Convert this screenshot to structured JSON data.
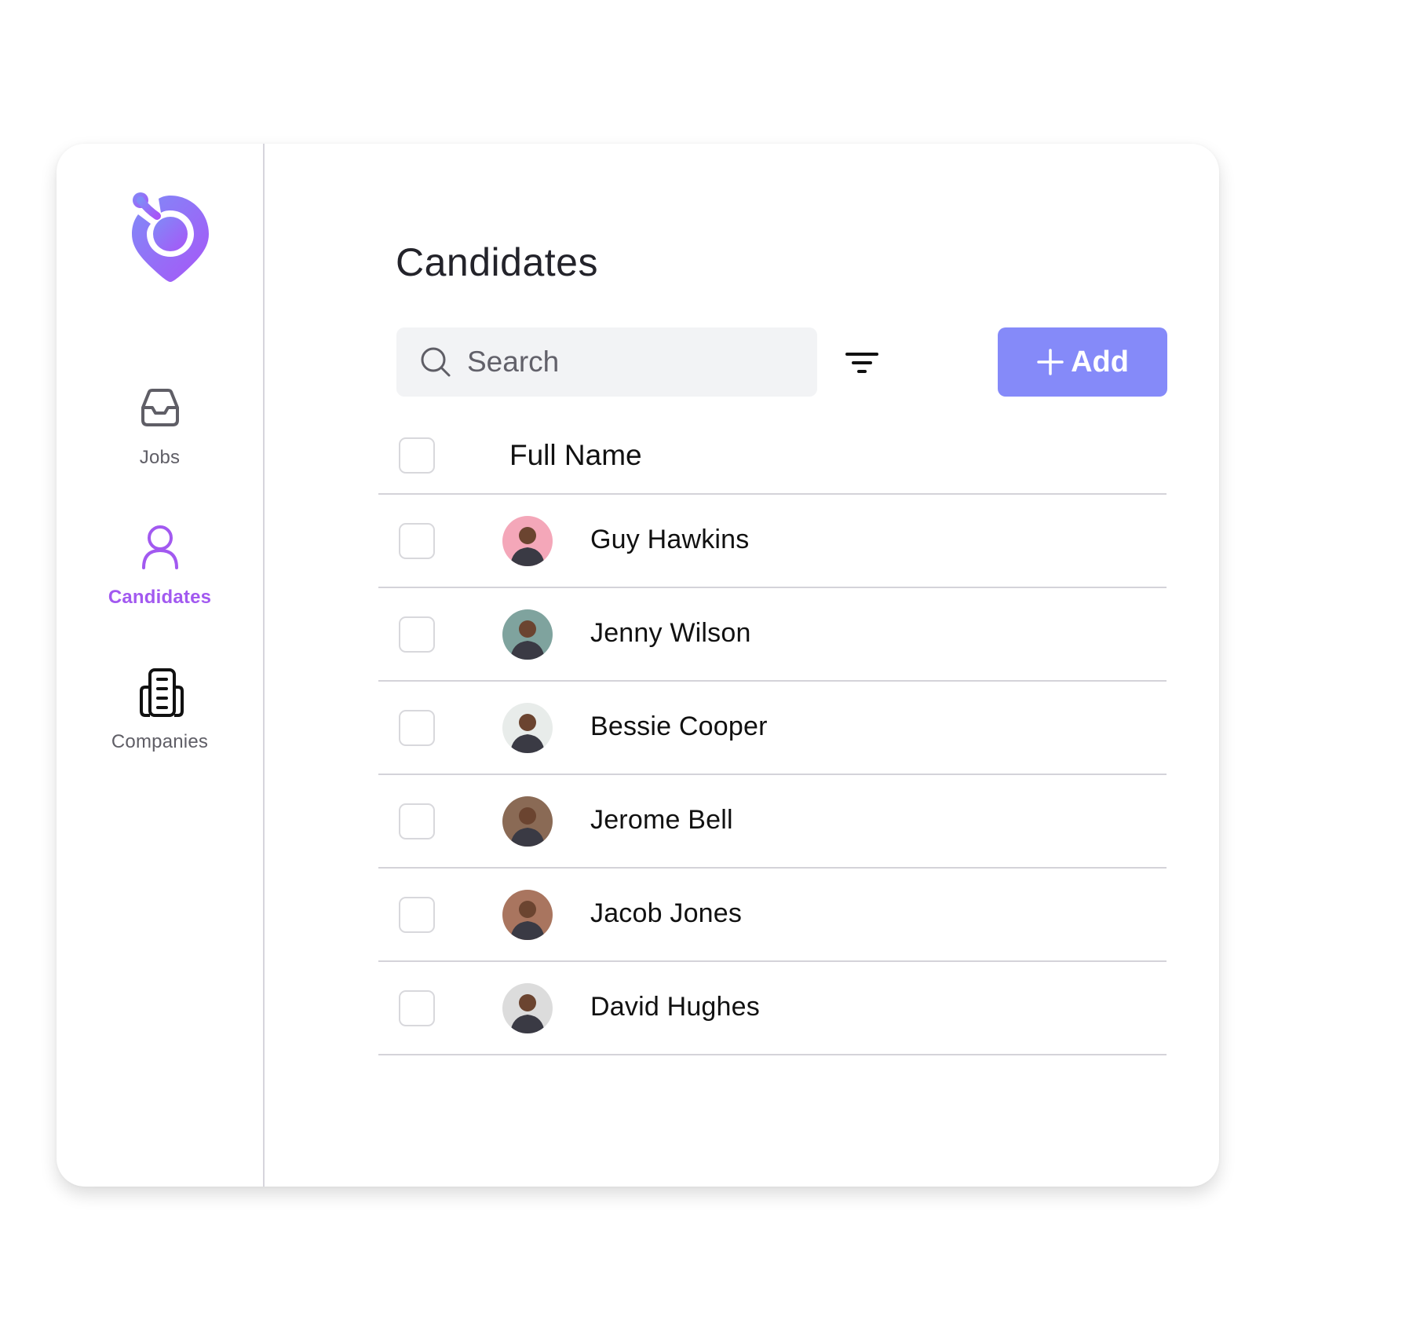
{
  "app": {
    "logo_icon": "location-pin-logo-icon",
    "brand_colors": {
      "logo_gradient_start": "#7f8cf7",
      "logo_gradient_end": "#a855f7"
    }
  },
  "sidebar": {
    "items": [
      {
        "label": "Jobs",
        "icon": "inbox-tray-icon",
        "active": false
      },
      {
        "label": "Candidates",
        "icon": "user-icon",
        "active": true
      },
      {
        "label": "Companies",
        "icon": "building-icon",
        "active": false
      }
    ],
    "active_color": "#a259f0"
  },
  "main": {
    "title": "Candidates",
    "search": {
      "placeholder": "Search",
      "value": "",
      "icon": "search-icon"
    },
    "filter": {
      "icon": "filter-icon"
    },
    "add_button": {
      "label": "Add",
      "icon": "plus-icon",
      "color": "#858af9"
    },
    "table": {
      "columns": [
        "Full Name"
      ],
      "rows": [
        {
          "name": "Guy Hawkins",
          "checked": false,
          "avatar_bg": "#f4a7b9"
        },
        {
          "name": "Jenny Wilson",
          "checked": false,
          "avatar_bg": "#7fa39e"
        },
        {
          "name": "Bessie Cooper",
          "checked": false,
          "avatar_bg": "#e8ecea"
        },
        {
          "name": "Jerome Bell",
          "checked": false,
          "avatar_bg": "#8a6a55"
        },
        {
          "name": "Jacob Jones",
          "checked": false,
          "avatar_bg": "#a9755f"
        },
        {
          "name": "David Hughes",
          "checked": false,
          "avatar_bg": "#dcdcdc"
        }
      ]
    }
  }
}
